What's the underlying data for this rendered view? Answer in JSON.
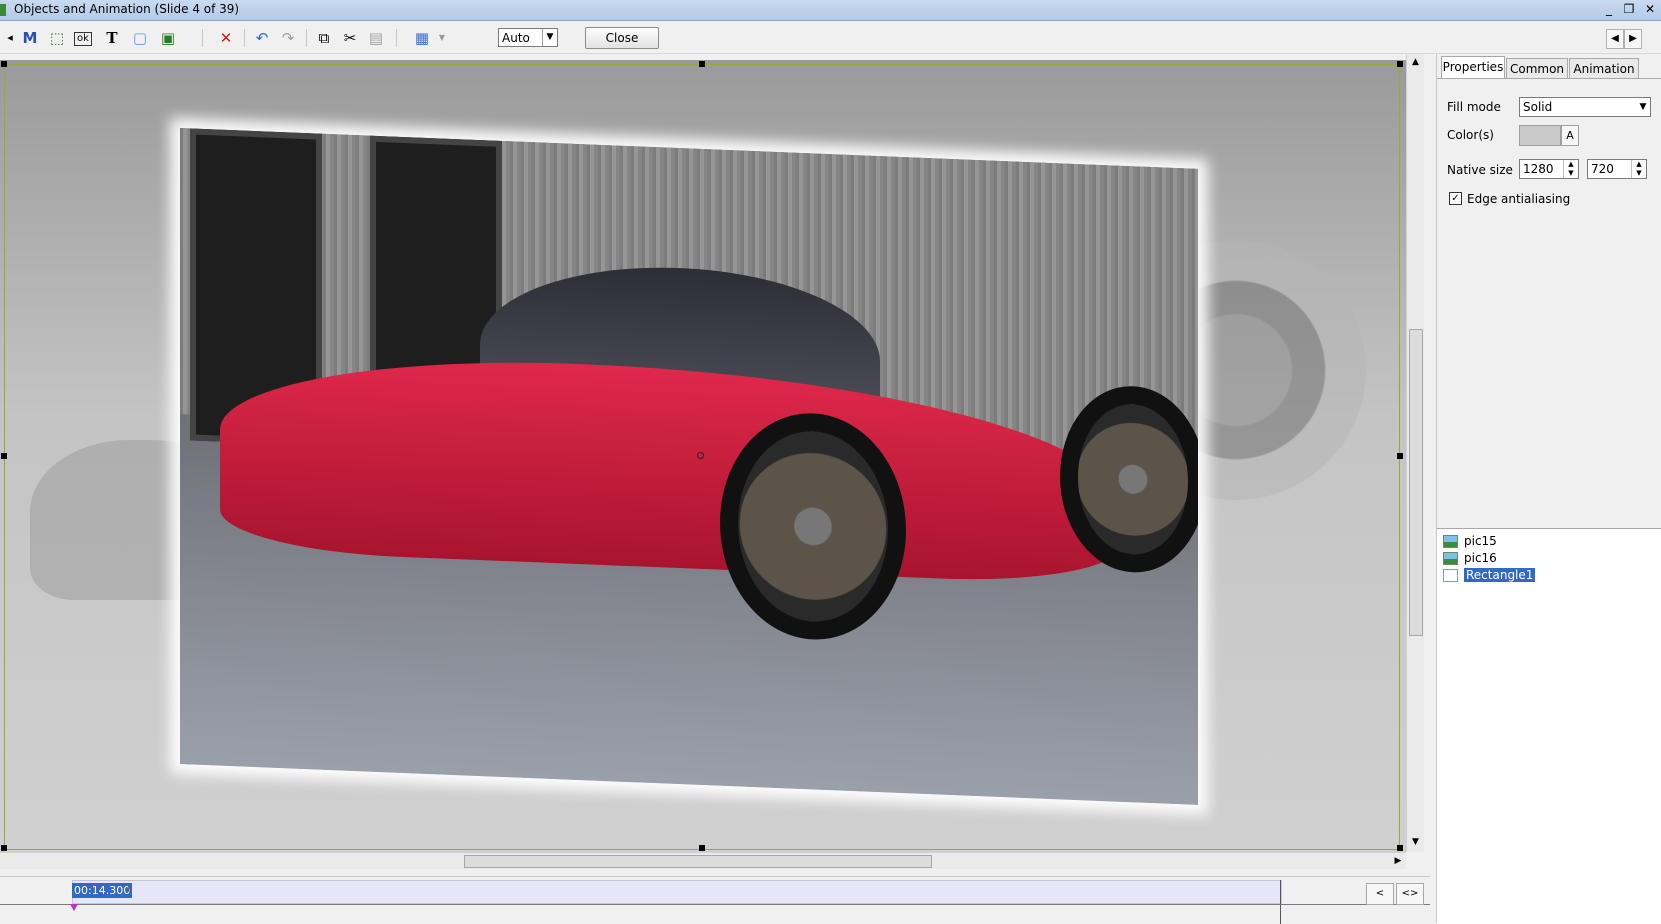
{
  "window": {
    "title": "Objects and Animation  (Slide 4 of 39)"
  },
  "toolbar": {
    "tool_m_glyph": "M",
    "tool_text_glyph": "T",
    "tool_button_glyph": "ok",
    "zoom_value": "Auto",
    "close_label": "Close"
  },
  "timeline": {
    "current_time": "00:14.300",
    "plus_glyph": "+",
    "prev_label": "<",
    "expand_label": "<>"
  },
  "panel": {
    "tabs": [
      "Properties",
      "Common",
      "Animation"
    ],
    "active_tab": "Properties",
    "fill_mode_label": "Fill mode",
    "fill_mode_value": "Solid",
    "colors_label": "Color(s)",
    "color_button_label": "A",
    "native_size_label": "Native size",
    "native_width": "1280",
    "native_height": "720",
    "edge_antialiasing_label": "Edge antialiasing",
    "edge_antialiasing_checked": true
  },
  "objects": {
    "items": [
      {
        "label": "pic15",
        "type": "picture"
      },
      {
        "label": "pic16",
        "type": "picture"
      },
      {
        "label": "Rectangle1",
        "type": "rectangle",
        "selected": true
      }
    ]
  },
  "colors": {
    "title_bar": "#b3cae8",
    "selection": "#3169c6",
    "car_red": "#d0203e",
    "frame_border": "#9aa83a"
  }
}
